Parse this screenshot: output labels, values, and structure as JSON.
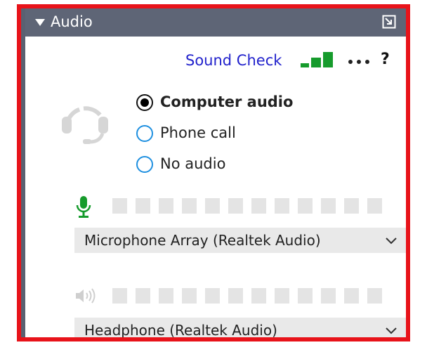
{
  "panel": {
    "title": "Audio",
    "popout_icon": "popout-icon",
    "collapse_icon": "collapse-triangle-icon"
  },
  "toolbar": {
    "sound_check": "Sound Check",
    "signal_icon": "signal-strength-icon",
    "more_icon": "more-options-icon",
    "help": "?"
  },
  "audio_mode": {
    "options": [
      {
        "label": "Computer audio",
        "selected": true
      },
      {
        "label": "Phone call",
        "selected": false
      },
      {
        "label": "No audio",
        "selected": false
      }
    ]
  },
  "microphone": {
    "icon": "microphone-icon",
    "level_segments": 12,
    "level_active": 0,
    "device": "Microphone Array (Realtek Audio)"
  },
  "speaker": {
    "icon": "speaker-icon",
    "level_segments": 12,
    "level_active": 0,
    "device": "Headphone (Realtek Audio)"
  },
  "colors": {
    "highlight_border": "#e8131a",
    "titlebar": "#5e6576",
    "link": "#2222cc",
    "signal": "#169b2c",
    "mic": "#169b2c",
    "radio_ring": "#1d8fe0",
    "dropdown_bg": "#e9e9e9"
  }
}
